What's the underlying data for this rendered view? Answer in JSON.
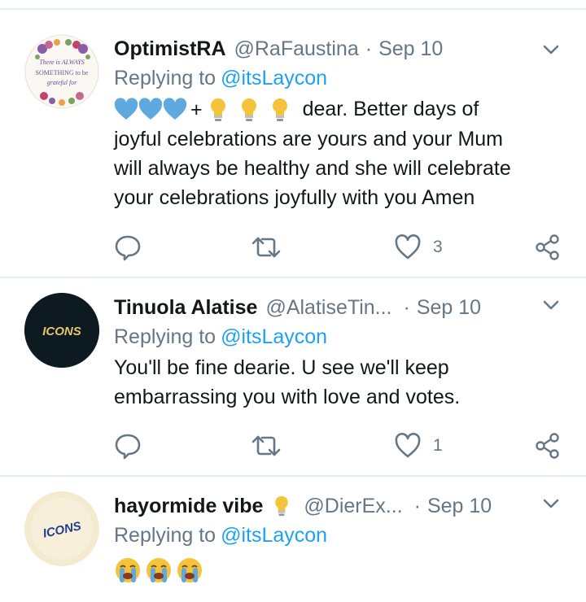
{
  "tweets": [
    {
      "name": "OptimistRA",
      "handle": "@RaFaustina",
      "separator": "·",
      "date": "Sep 10",
      "replying_prefix": "Replying to",
      "replying_to": "@itsLaycon",
      "emoji_prefix": "💙💙💙+💡💡💡",
      "plus": "+",
      "text_after_emoji": "dear. Better days of",
      "text_lines": [
        "joyful celebrations are yours and your Mum",
        "will always be healthy and she will celebrate",
        "your celebrations joyfully with you Amen"
      ],
      "avatar_text_1": "There is ALWAYS",
      "avatar_text_2": "SOMETHING to be",
      "avatar_text_3": "grateful for",
      "likes": "3",
      "replies": "",
      "retweets": ""
    },
    {
      "name": "Tinuola Alatise",
      "handle": "@AlatiseTin...",
      "separator": "·",
      "date": "Sep 10",
      "replying_prefix": "Replying to",
      "replying_to": "@itsLaycon",
      "text_lines": [
        "You'll be fine dearie. U see we'll keep",
        "embarrassing you with love and votes."
      ],
      "avatar_text": "ICONS",
      "likes": "1",
      "replies": "",
      "retweets": ""
    },
    {
      "name": "hayormide vibe",
      "name_emoji": "💡",
      "handle": "@DierEx...",
      "separator": "·",
      "date": "Sep 10",
      "replying_prefix": "Replying to",
      "replying_to": "@itsLaycon",
      "text": "😭😭😭",
      "avatar_text": "ICONS"
    }
  ],
  "colors": {
    "link": "#1da1f2",
    "muted": "#657786",
    "text": "#14171a",
    "divider": "#e6ecf0",
    "heart_blue": "#5ea9e0",
    "bulb": "#f5c33b"
  },
  "icons": [
    "reply-icon",
    "retweet-icon",
    "like-icon",
    "share-icon",
    "chevron-down-icon",
    "blue-heart-emoji",
    "light-bulb-emoji",
    "crying-face-emoji"
  ]
}
